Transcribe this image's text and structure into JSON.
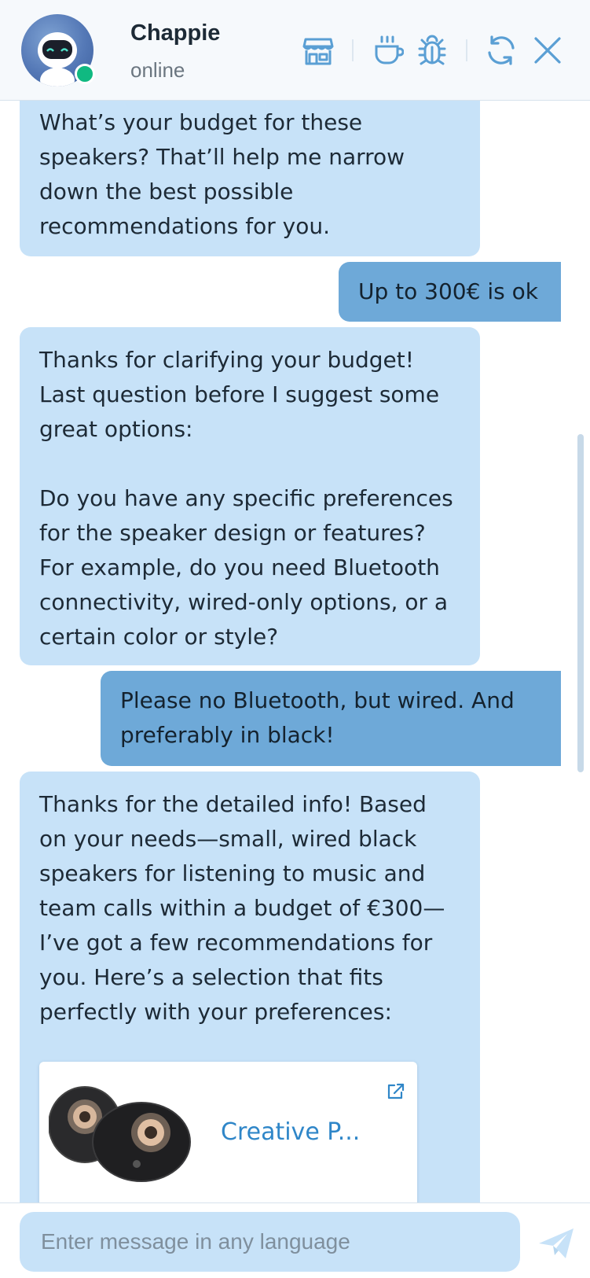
{
  "header": {
    "bot_name": "Chappie",
    "bot_status": "online",
    "icons": [
      "store-icon",
      "coffee-icon",
      "bug-icon",
      "refresh-icon",
      "close-icon"
    ]
  },
  "messages": [
    {
      "role": "bot",
      "text": "What’s your budget for these\nspeakers? That’ll help me narrow\ndown the best possible\nrecommendations for you."
    },
    {
      "role": "user",
      "text": "Up to 300€ is ok"
    },
    {
      "role": "bot",
      "text": "Thanks for clarifying your budget!\nLast question before I suggest some\ngreat options:\n\nDo you have any specific preferences\nfor the speaker design or features?\nFor example, do you need Bluetooth\nconnectivity, wired-only options, or a\ncertain color or style?"
    },
    {
      "role": "user",
      "text": "Please no Bluetooth, but wired. And\npreferably in black!"
    },
    {
      "role": "bot",
      "text": "Thanks for the detailed info! Based\non your needs—small, wired black\nspeakers for listening to music and\nteam calls within a budget of €300—\nI’ve got a few recommendations for\nyou. Here’s a selection that fits\nperfectly with your preferences:"
    }
  ],
  "product_card": {
    "title": "Creative P...",
    "icons": [
      "speaker-product-image",
      "external-link-icon"
    ]
  },
  "composer": {
    "placeholder": "Enter message in any language",
    "value": ""
  },
  "colors": {
    "bot_bubble": "#c7e2f8",
    "user_bubble": "#6ea9d8",
    "accent": "#2f86c8",
    "online": "#10b981"
  }
}
